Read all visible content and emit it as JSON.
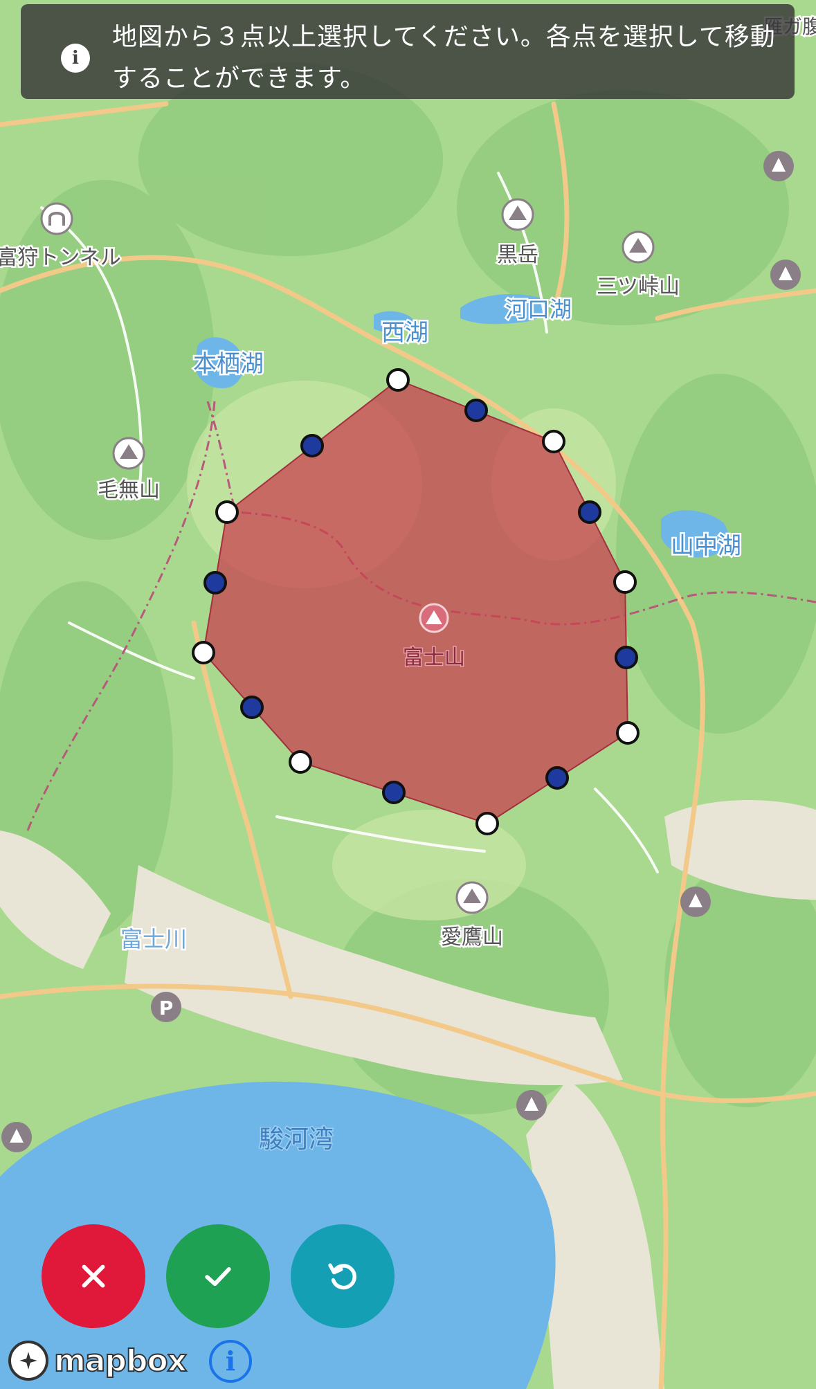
{
  "banner": {
    "icon": "info-icon",
    "message": "地図から３点以上選択してください。各点を選択して移動することができます。"
  },
  "map": {
    "labels": [
      {
        "key": "karigatake",
        "text": "雁ガ腹"
      },
      {
        "key": "kurodake",
        "text": "黒岳"
      },
      {
        "key": "mitsutoge",
        "text": "三ツ峠山"
      },
      {
        "key": "kawaguchiko",
        "text": "河口湖"
      },
      {
        "key": "saiko",
        "text": "西湖"
      },
      {
        "key": "motosuko",
        "text": "本栖湖"
      },
      {
        "key": "tunnel",
        "text": "富狩トンネル"
      },
      {
        "key": "kenashi",
        "text": "毛無山"
      },
      {
        "key": "yamanakako",
        "text": "山中湖"
      },
      {
        "key": "fuji",
        "text": "富士山"
      },
      {
        "key": "ashitaka",
        "text": "愛鷹山"
      },
      {
        "key": "fujikawa",
        "text": "富士川"
      },
      {
        "key": "surugawan",
        "text": "駿河湾"
      }
    ],
    "colors": {
      "forest": "#a9d98f",
      "water": "#6fb6e8",
      "urban": "#e8e4d8",
      "polygon_fill": "#c8414f",
      "vertex_fill": "#ffffff",
      "midpoint_fill": "#1f3a9e"
    }
  },
  "controls": {
    "cancel": {
      "icon": "close-icon",
      "color": "#e0193a"
    },
    "confirm": {
      "icon": "check-icon",
      "color": "#1ea152"
    },
    "reset": {
      "icon": "undo-icon",
      "color": "#149fb4"
    }
  },
  "attribution": {
    "logo_text": "mapbox",
    "info_icon": "info-icon"
  }
}
